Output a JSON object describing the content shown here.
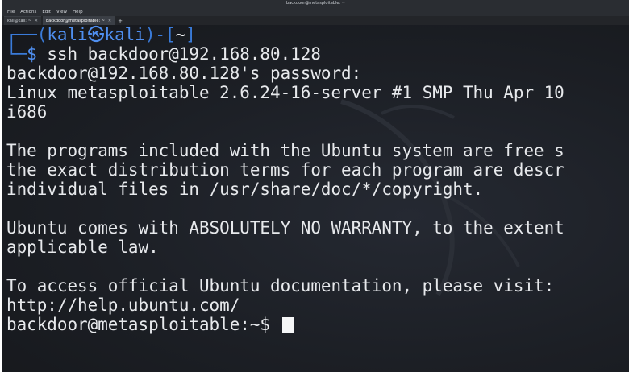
{
  "window": {
    "title": "backdoor@metasploitable: ~"
  },
  "menu": [
    "File",
    "Actions",
    "Edit",
    "View",
    "Help"
  ],
  "tabs": [
    {
      "label": "kali@kali: ~"
    },
    {
      "label": "backdoor@metasploitable: ~"
    }
  ],
  "prompt": {
    "open": "┌──(",
    "user": "kali",
    "skull": "㉿",
    "host": "kali",
    "mid": ")-[",
    "dir": "~",
    "close": "]",
    "corner": "└─",
    "dollar": "$",
    "command": "ssh backdoor@192.168.80.128"
  },
  "output": [
    "backdoor@192.168.80.128's password:",
    "Linux metasploitable 2.6.24-16-server #1 SMP Thu Apr 10",
    "i686",
    "",
    "The programs included with the Ubuntu system are free s",
    "the exact distribution terms for each program are descr",
    "individual files in /usr/share/doc/*/copyright.",
    "",
    "Ubuntu comes with ABSOLUTELY NO WARRANTY, to the extent",
    "applicable law.",
    "",
    "To access official Ubuntu documentation, please visit:",
    "http://help.ubuntu.com/"
  ],
  "final_prompt": "backdoor@metasploitable:~$ ",
  "colors": {
    "prompt_blue": "#4f8ff0",
    "frame_blue": "#3a7bd9",
    "text": "#e7e9ec",
    "background": "#1b1e23"
  }
}
